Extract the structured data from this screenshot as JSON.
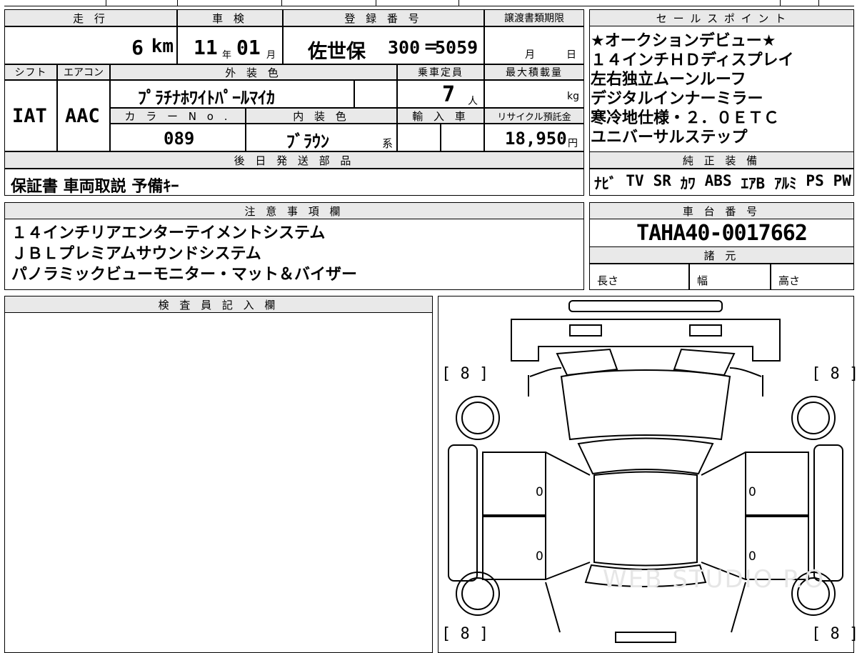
{
  "header": {
    "mileage_label": "走 行",
    "inspection_label": "車 検",
    "registration_label": "登 録 番 号",
    "transfer_deadline_label": "譲渡書類期限",
    "sales_points_label": "セ ー ル ス ポ イ ン ト"
  },
  "mileage": {
    "value": "6",
    "unit": "km"
  },
  "inspection": {
    "year": "11",
    "year_unit": "年",
    "month": "01",
    "month_unit": "月"
  },
  "registration": {
    "area": "佐世保",
    "class": "300",
    "sep": "=",
    "number": "5059"
  },
  "transfer_deadline": {
    "month_unit": "月",
    "day_unit": "日"
  },
  "row2": {
    "shift_label": "シフト",
    "ac_label": "エアコン",
    "exterior_label": "外 装 色",
    "capacity_label": "乗車定員",
    "max_load_label": "最大積載量"
  },
  "shift": "IAT",
  "aircon": "AAC",
  "exterior_color": "ﾌﾟﾗﾁﾅﾎﾜｲﾄﾊﾟｰﾙﾏｲｶ",
  "capacity": {
    "value": "7",
    "unit": "人"
  },
  "max_load": {
    "unit": "kg"
  },
  "row3": {
    "color_no_label": "カ ラ ー N o .",
    "interior_label": "内 装 色",
    "import_label": "輸 入 車",
    "recycle_label": "リサイクル預託金"
  },
  "color_no": "089",
  "interior": {
    "value": "ﾌﾞﾗｳﾝ",
    "suffix": "系"
  },
  "recycle_fee": {
    "value": "18,950",
    "unit": "円"
  },
  "sales_points": [
    "★オークションデビュー★",
    "１４インチＨＤディスプレイ",
    "左右独立ムーンルーフ",
    "デジタルインナーミラー",
    "寒冷地仕様・２．０ＥＴＣ",
    "ユニバーサルステップ"
  ],
  "later_parts": {
    "label": "後 日 発 送 部 品",
    "value": "保証書 車両取説 予備ｷｰ"
  },
  "genuine_equipment": {
    "label": "純 正 装 備",
    "items": [
      "ﾅﾋﾞ",
      "TV",
      "SR",
      "ｶﾜ",
      "ABS",
      "ｴｱB",
      "ｱﾙﾐ",
      "PS",
      "PW"
    ]
  },
  "notes": {
    "label": "注 意 事 項 欄",
    "lines": [
      "１４インチリアエンターテイメントシステム",
      "ＪＢＬプレミアムサウンドシステム",
      "パノラミックビューモニター・マット＆バイザー"
    ]
  },
  "chassis": {
    "label": "車 台 番 号",
    "value": "TAHA40-0017662"
  },
  "specs": {
    "label": "諸 元",
    "length": "長さ",
    "width": "幅",
    "height": "高さ"
  },
  "inspector": {
    "label": "検 査 員 記 入 欄"
  },
  "diagram": {
    "tire_fl": "[ 8 ]",
    "tire_fr": "[ 8 ]",
    "tire_rl": "[ 8 ]",
    "tire_rr": "[ 8 ]",
    "door_lf": "0",
    "door_lr": "0",
    "door_rf": "0",
    "door_rr": "0",
    "watermark": "WEB STUDIO P.O"
  }
}
